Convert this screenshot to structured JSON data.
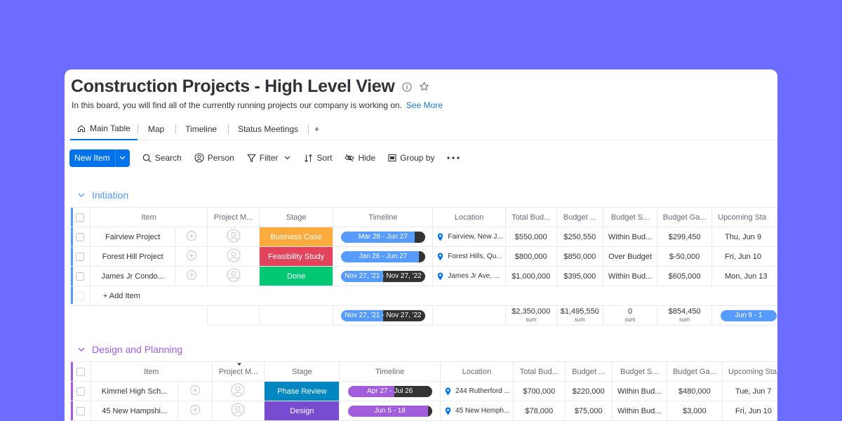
{
  "header": {
    "title": "Construction Projects - High Level View",
    "description": "In this board, you will find all of the currently running projects our company is working on.",
    "see_more": "See More"
  },
  "tabs": [
    {
      "label": "Main Table"
    },
    {
      "label": "Map"
    },
    {
      "label": "Timeline"
    },
    {
      "label": "Status Meetings"
    },
    {
      "label": "+"
    }
  ],
  "toolbar": {
    "new_item": "New Item",
    "search": "Search",
    "person": "Person",
    "filter": "Filter",
    "sort": "Sort",
    "hide": "Hide",
    "group_by": "Group by"
  },
  "columns": [
    "Item",
    "Project M...",
    "Stage",
    "Timeline",
    "Location",
    "Total Bud...",
    "Budget ...",
    "Budget S...",
    "Budget Ga...",
    "Upcoming Sta"
  ],
  "colors": {
    "accent": "#0073ea",
    "background": "#6c6cff",
    "initiation": "#579bfc",
    "design": "#a25ddc"
  },
  "groups": [
    {
      "title": "Initiation",
      "color": "#579bfc",
      "rows": [
        {
          "item": "Fairview Project",
          "stage": "Business Case",
          "stage_color": "#fdab3d",
          "timeline": "Mar 28 - Jun 27",
          "timeline_progress": 0.88,
          "location": "Fairview, New J...",
          "total_budget": "$550,000",
          "budget": "$250,550",
          "budget_status": "Within Bud...",
          "budget_gap": "$299,450",
          "upcoming": "Thu, Jun 9"
        },
        {
          "item": "Forest Hill Project",
          "stage": "Feasibility Study",
          "stage_color": "#e2445c",
          "timeline": "Jan 26 - Jun 27",
          "timeline_progress": 0.93,
          "location": "Forest Hills, Qu...",
          "total_budget": "$800,000",
          "budget": "$850,000",
          "budget_status": "Over Budget",
          "budget_gap": "$-50,000",
          "upcoming": "Fri, Jun 10"
        },
        {
          "item": "James Jr Condo...",
          "stage": "Done",
          "stage_color": "#00c875",
          "timeline": "Nov 27, '21 - Nov 27, '22",
          "timeline_progress": 0.5,
          "location": "James Jr Ave, ...",
          "total_budget": "$1,000,000",
          "budget": "$395,000",
          "budget_status": "Within Bud...",
          "budget_gap": "$605,000",
          "upcoming": "Mon, Jun 13"
        }
      ],
      "add_item": "+ Add Item",
      "summary": {
        "timeline": "Nov 27, '21 - Nov 27, '22",
        "total_budget": "$2,350,000",
        "budget": "$1,495,550",
        "budget_status": "0",
        "budget_gap": "$854,450",
        "sum_label": "sum",
        "upcoming": "Jun 9 - 1"
      }
    },
    {
      "title": "Design and Planning",
      "color": "#a25ddc",
      "rows": [
        {
          "item": "Kimmel High Sch...",
          "stage": "Phase Review",
          "stage_color": "#0086c0",
          "timeline": "Apr 27 - Jul 26",
          "timeline_progress": 0.55,
          "location": "244 Rutherford ...",
          "total_budget": "$700,000",
          "budget": "$220,000",
          "budget_status": "Within Bud...",
          "budget_gap": "$480,000",
          "upcoming": "Tue, Jun 7"
        },
        {
          "item": "45 New Hampshi...",
          "stage": "Design",
          "stage_color": "#784bd1",
          "timeline": "Jun 5 - 18",
          "timeline_progress": 0.95,
          "location": "45 New Hemph...",
          "total_budget": "$78,000",
          "budget": "$75,000",
          "budget_status": "Within Bud...",
          "budget_gap": "$3,000",
          "upcoming": "Fri, Jun 10"
        }
      ]
    }
  ]
}
